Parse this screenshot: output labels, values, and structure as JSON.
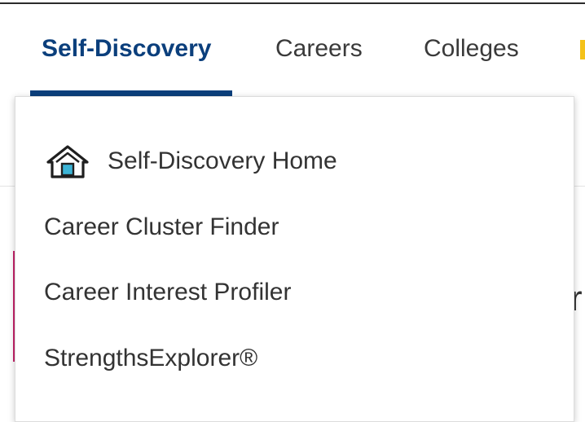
{
  "nav": {
    "tabs": [
      {
        "label": "Self-Discovery",
        "active": true
      },
      {
        "label": "Careers",
        "active": false
      },
      {
        "label": "Colleges",
        "active": false
      }
    ]
  },
  "dropdown": {
    "home": {
      "label": "Self-Discovery Home",
      "icon": "home-icon"
    },
    "items": [
      {
        "label": "Career Cluster Finder"
      },
      {
        "label": "Career Interest Profiler"
      },
      {
        "label": "StrengthsExplorer®"
      }
    ]
  },
  "background": {
    "partial_text": "r"
  },
  "colors": {
    "active_tab": "#0b3f7c",
    "text": "#333333",
    "icon_accent": "#3cb4d6",
    "overflow_tab_accent": "#f4c21a",
    "background_accent": "#c7236a"
  }
}
